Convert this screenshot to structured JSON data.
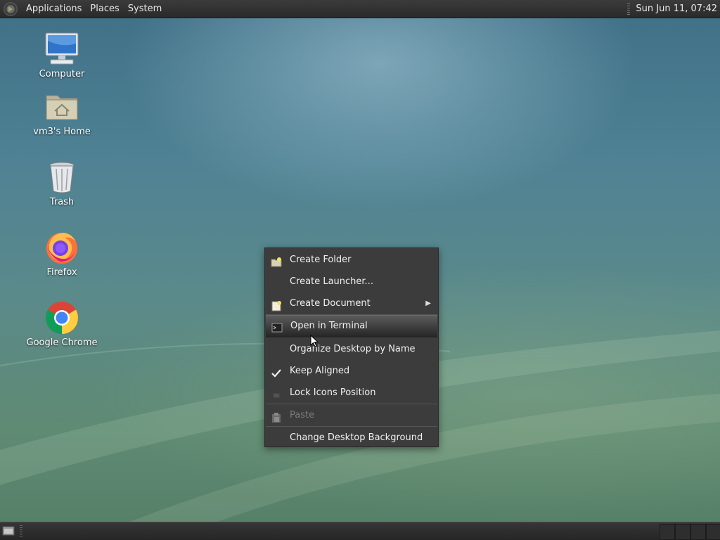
{
  "top_panel": {
    "menus": [
      "Applications",
      "Places",
      "System"
    ],
    "clock": "Sun Jun 11, 07:42",
    "logo_icon": "distro-logo-icon"
  },
  "desktop_icons": [
    {
      "label": "Computer",
      "icon": "computer-icon"
    },
    {
      "label": "vm3's Home",
      "icon": "home-folder-icon"
    },
    {
      "label": "Trash",
      "icon": "trash-icon"
    },
    {
      "label": "Firefox",
      "icon": "firefox-icon"
    },
    {
      "label": "Google Chrome",
      "icon": "chrome-icon"
    }
  ],
  "context_menu": {
    "items": [
      {
        "label": "Create Folder",
        "icon": "new-folder-icon"
      },
      {
        "label": "Create Launcher...",
        "icon": ""
      },
      {
        "label": "Create Document",
        "icon": "new-document-icon",
        "submenu": true
      },
      {
        "label": "Open in Terminal",
        "icon": "terminal-icon",
        "highlighted": true
      },
      {
        "label": "Organize Desktop by Name",
        "icon": ""
      },
      {
        "label": "Keep Aligned",
        "icon": "check-icon",
        "checked": true
      },
      {
        "label": "Lock Icons Position",
        "icon": "unchecked-box-icon"
      },
      {
        "label": "Paste",
        "icon": "paste-icon",
        "disabled": true
      },
      {
        "label": "Change Desktop Background",
        "icon": ""
      }
    ],
    "submenu_arrow": "▶"
  },
  "colors": {
    "panel_bg": "#2e2e2e",
    "menu_bg": "#3c3c3c",
    "highlight": "#4a4a4a",
    "desktop_top": "#3f6f86",
    "desktop_bottom": "#557e66"
  }
}
